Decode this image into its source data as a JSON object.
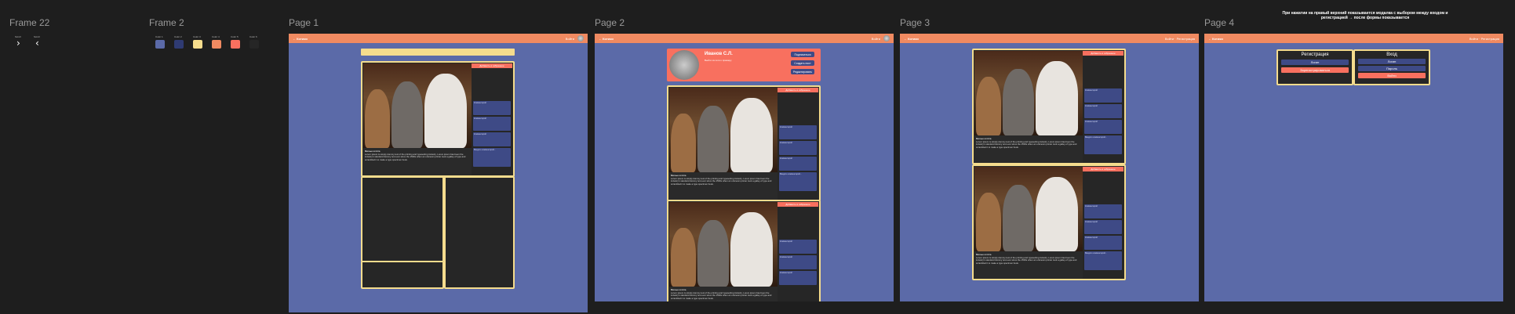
{
  "frames": {
    "frame22": {
      "label": "Frame 22",
      "btn1": "Scroll",
      "btn2": "Scroll",
      "icon1": "chevron-right-icon",
      "icon2": "chevron-left-icon"
    },
    "frame2": {
      "label": "Frame 2",
      "colors": [
        {
          "name": "Color 1",
          "hex": "#5b6aa8"
        },
        {
          "name": "Color 2",
          "hex": "#2f3b73"
        },
        {
          "name": "Color 3",
          "hex": "#f5dc8d"
        },
        {
          "name": "Color 4",
          "hex": "#f08a61"
        },
        {
          "name": "Color 5",
          "hex": "#f8705f"
        },
        {
          "name": "Color 6",
          "hex": "#262626"
        }
      ]
    },
    "page1": {
      "label": "Page 1",
      "logo": "← Котики",
      "search": "Войти"
    },
    "page2": {
      "label": "Page 2",
      "logo": "← Котики",
      "user": "Иванов С.Л.",
      "user_sub": "Выйти из сети к примеру",
      "btns": [
        "Подписаться",
        "Создать пост",
        "Редактировать"
      ]
    },
    "page3": {
      "label": "Page 3",
      "logo": "← Котики",
      "right": "Войти · Регистрация"
    },
    "page4": {
      "label": "Page 4",
      "logo": "← Котики",
      "right": "Войти · Регистрация",
      "reg_title": "Регистрация",
      "login_title": "Вход",
      "reg_fields": [
        "Логин",
        "Зарегистрироваться"
      ],
      "login_fields": [
        "Логин",
        "Пароль",
        "Войти"
      ]
    }
  },
  "note": "При нажатии на правый верхний показывается модалка с выбором между входом и регистрацией → после формы показывается",
  "post": {
    "title": "Милые котята",
    "comments": "Комментарии",
    "author": "Автор",
    "badge": "Добавить в избранное",
    "comment_label": "Комментарий",
    "body": "Lorem ipsum is simply dummy text of the printing and typesetting industry. Lorem ipsum has been the industry's standard dummy text ever since the 1500s when an unknown printer took a galley of type and scrambled it to make a type specimen book.",
    "placeholder": "Введите комментарий..."
  }
}
